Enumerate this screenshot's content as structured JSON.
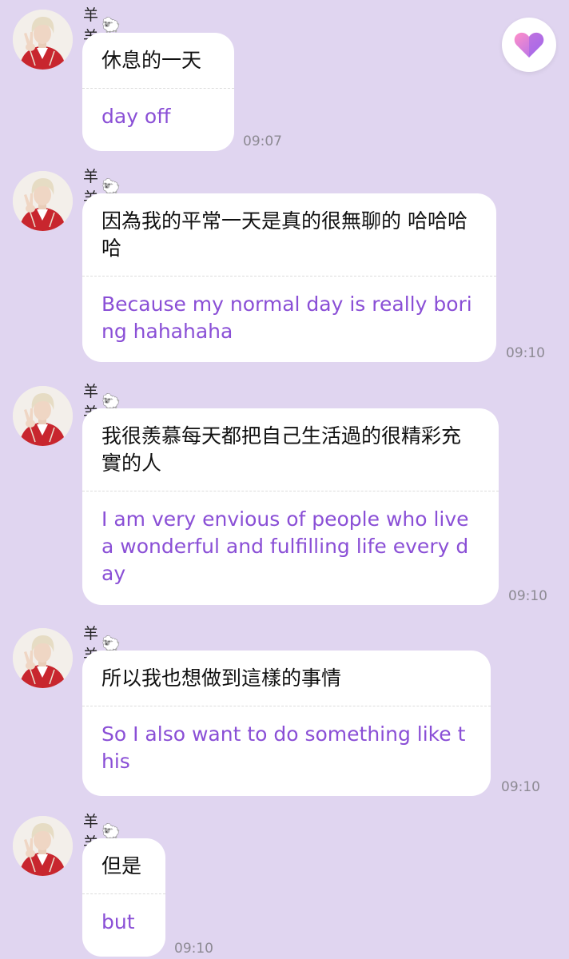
{
  "messages": [
    {
      "sender": "羊羊",
      "sender_emoji": "🐑",
      "original": "休息的一天",
      "translation": "day off",
      "time": "09:07"
    },
    {
      "sender": "羊羊",
      "sender_emoji": "🐑",
      "original": "因為我的平常一天是真的很無聊的 哈哈哈哈",
      "translation": "Because my normal day is really boring hahahaha",
      "time": "09:10"
    },
    {
      "sender": "羊羊",
      "sender_emoji": "🐑",
      "original": "我很羨慕每天都把自己生活過的很精彩充實的人",
      "translation": "I am very envious of people who live a wonderful and fulfilling life every day",
      "time": "09:10"
    },
    {
      "sender": "羊羊",
      "sender_emoji": "🐑",
      "original": "所以我也想做到這樣的事情",
      "translation": "So I also want to do something like this",
      "time": "09:10"
    },
    {
      "sender": "羊羊",
      "sender_emoji": "🐑",
      "original": "但是",
      "translation": "but",
      "time": "09:10"
    }
  ],
  "colors": {
    "background": "#e0d5f0",
    "translation_text": "#8a4fd6",
    "heart_gradient": [
      "#ff8fc8",
      "#a86df0"
    ]
  },
  "icons": {
    "favorite": "heart-icon",
    "sender_badge": "sheep-emoji"
  }
}
